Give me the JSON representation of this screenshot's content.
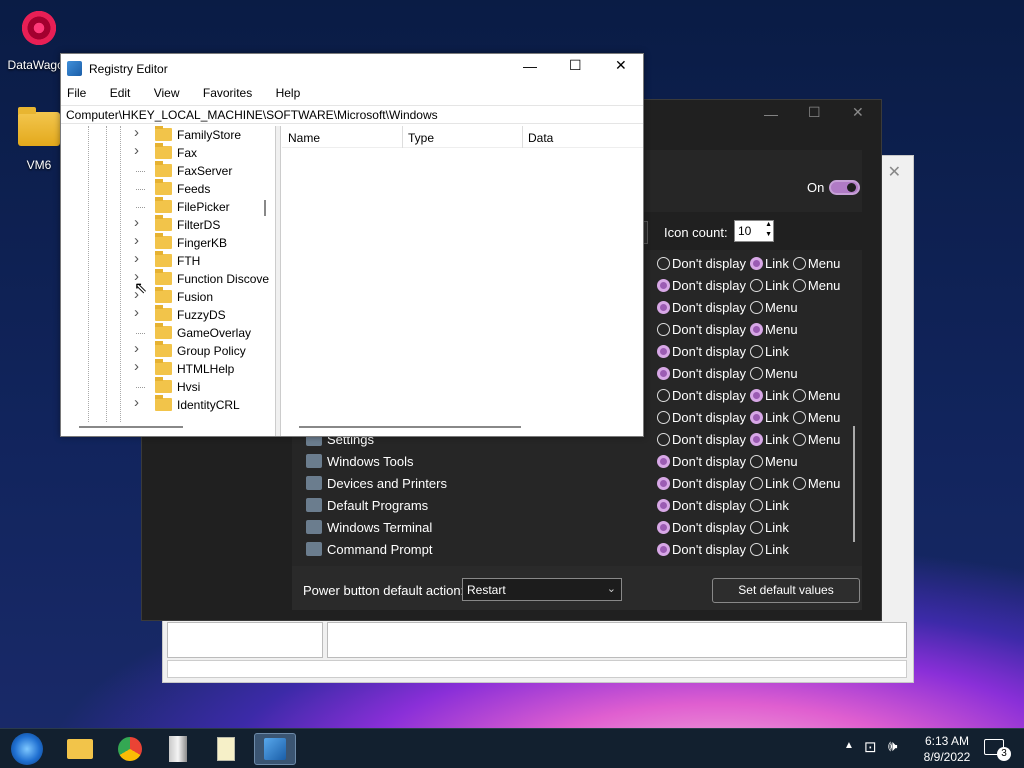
{
  "desktop": {
    "icons": [
      {
        "label": "DataWagon",
        "glyph": "flower-icon"
      },
      {
        "label": "VM6",
        "glyph": "folder-icon"
      }
    ]
  },
  "dark_dialog": {
    "toggle_label": "On",
    "icon_count_label": "Icon count:",
    "icon_count_value": "10",
    "rows": [
      {
        "options": [
          {
            "label": "Don't display",
            "selected": false
          },
          {
            "label": "Link",
            "selected": true
          },
          {
            "label": "Menu",
            "selected": false
          }
        ]
      },
      {
        "options": [
          {
            "label": "Don't display",
            "selected": true
          },
          {
            "label": "Link",
            "selected": false
          },
          {
            "label": "Menu",
            "selected": false
          }
        ]
      },
      {
        "options": [
          {
            "label": "Don't display",
            "selected": true
          },
          {
            "label": "Menu",
            "selected": false
          }
        ]
      },
      {
        "options": [
          {
            "label": "Don't display",
            "selected": false
          },
          {
            "label": "Menu",
            "selected": true
          }
        ]
      },
      {
        "options": [
          {
            "label": "Don't display",
            "selected": true
          },
          {
            "label": "Link",
            "selected": false
          }
        ]
      },
      {
        "options": [
          {
            "label": "Don't display",
            "selected": true
          },
          {
            "label": "Menu",
            "selected": false
          }
        ]
      },
      {
        "options": [
          {
            "label": "Don't display",
            "selected": false
          },
          {
            "label": "Link",
            "selected": true
          },
          {
            "label": "Menu",
            "selected": false
          }
        ]
      },
      {
        "options": [
          {
            "label": "Don't display",
            "selected": false
          },
          {
            "label": "Link",
            "selected": true
          },
          {
            "label": "Menu",
            "selected": false
          }
        ]
      },
      {
        "options": [
          {
            "label": "Don't display",
            "selected": false
          },
          {
            "label": "Link",
            "selected": true
          },
          {
            "label": "Menu",
            "selected": false
          }
        ]
      },
      {
        "options": [
          {
            "label": "Don't display",
            "selected": true
          },
          {
            "label": "Menu",
            "selected": false
          }
        ]
      },
      {
        "options": [
          {
            "label": "Don't display",
            "selected": true
          },
          {
            "label": "Link",
            "selected": false
          },
          {
            "label": "Menu",
            "selected": false
          }
        ]
      },
      {
        "options": [
          {
            "label": "Don't display",
            "selected": true
          },
          {
            "label": "Link",
            "selected": false
          }
        ]
      },
      {
        "options": [
          {
            "label": "Don't display",
            "selected": true
          },
          {
            "label": "Link",
            "selected": false
          }
        ]
      },
      {
        "options": [
          {
            "label": "Don't display",
            "selected": true
          },
          {
            "label": "Link",
            "selected": false
          }
        ]
      }
    ],
    "items": [
      {
        "label": "Settings",
        "icon": "gear-icon"
      },
      {
        "label": "Windows Tools",
        "icon": "tools-icon"
      },
      {
        "label": "Devices and Printers",
        "icon": "printer-icon"
      },
      {
        "label": "Default Programs",
        "icon": "default-programs-icon"
      },
      {
        "label": "Windows Terminal",
        "icon": "terminal-icon"
      },
      {
        "label": "Command Prompt",
        "icon": "cmd-icon"
      }
    ],
    "power_label": "Power button default action:",
    "power_value": "Restart",
    "set_default_label": "Set default values"
  },
  "registry": {
    "title": "Registry Editor",
    "menu": [
      "File",
      "Edit",
      "View",
      "Favorites",
      "Help"
    ],
    "address": "Computer\\HKEY_LOCAL_MACHINE\\SOFTWARE\\Microsoft\\Windows",
    "tree": [
      {
        "label": "FamilyStore",
        "expandable": true
      },
      {
        "label": "Fax",
        "expandable": true
      },
      {
        "label": "FaxServer",
        "expandable": false
      },
      {
        "label": "Feeds",
        "expandable": false
      },
      {
        "label": "FilePicker",
        "expandable": false
      },
      {
        "label": "FilterDS",
        "expandable": true
      },
      {
        "label": "FingerKB",
        "expandable": true
      },
      {
        "label": "FTH",
        "expandable": true
      },
      {
        "label": "Function Discove",
        "expandable": true
      },
      {
        "label": "Fusion",
        "expandable": true
      },
      {
        "label": "FuzzyDS",
        "expandable": true
      },
      {
        "label": "GameOverlay",
        "expandable": false
      },
      {
        "label": "Group Policy",
        "expandable": true
      },
      {
        "label": "HTMLHelp",
        "expandable": true
      },
      {
        "label": "Hvsi",
        "expandable": false
      },
      {
        "label": "IdentityCRL",
        "expandable": true
      }
    ],
    "columns": [
      "Name",
      "Type",
      "Data"
    ]
  },
  "taskbar": {
    "time": "6:13 AM",
    "date": "8/9/2022",
    "notification_count": "3",
    "apps": [
      "start-orb-icon",
      "file-explorer-icon",
      "chrome-icon",
      "archive-icon",
      "notepad-icon",
      "registry-editor-icon"
    ]
  }
}
